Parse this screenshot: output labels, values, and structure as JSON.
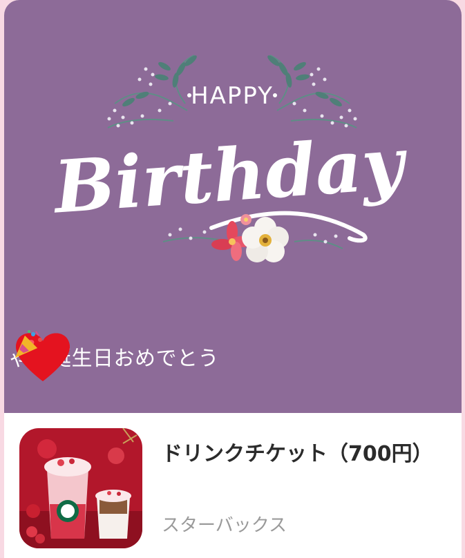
{
  "card": {
    "art_heading_small": "HAPPY",
    "art_heading_large": "Birthday",
    "message_text": "ゃん誕生日おめでとう",
    "hearts_icon": "red-heart-emoji",
    "party_icon": "party-popper-emoji",
    "background_color": "#8d6b98"
  },
  "gift": {
    "title": "ドリンクチケット（700円）",
    "brand": "スターバックス",
    "thumbnail_icon": "starbucks-drink-photo"
  }
}
